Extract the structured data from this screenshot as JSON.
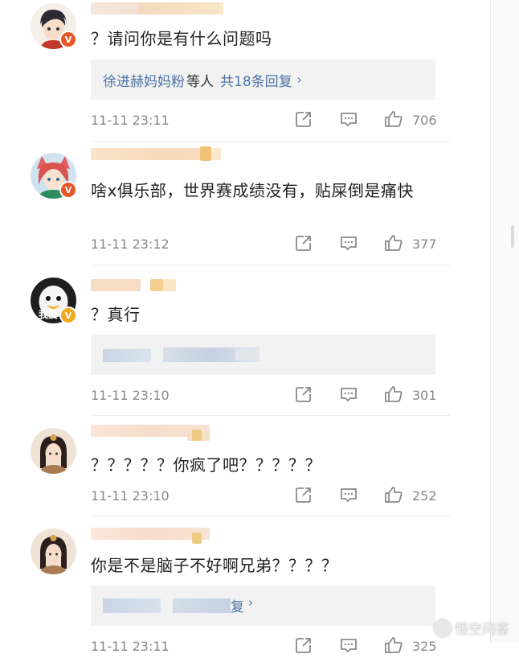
{
  "comments": [
    {
      "text": "？请问你是有什么问题吗",
      "reply": {
        "names": "徐进赫妈妈粉",
        "mid": "等人",
        "total": "共18条回复",
        "chevron": "›"
      },
      "time": "11-11 23:11",
      "likes": "706",
      "badge": "V",
      "badge_color": "#e8572a"
    },
    {
      "text": "啥x俱乐部，世界赛成绩没有，贴屎倒是痛快",
      "time": "11-11 23:12",
      "likes": "377",
      "badge": "V",
      "badge_color": "#e8572a"
    },
    {
      "text": "？真行",
      "time": "11-11 23:10",
      "likes": "301",
      "avatar_label": "我爱",
      "badge": "V",
      "badge_color": "#f2a81f"
    },
    {
      "text": "？？？？？你疯了吧？？？？？",
      "time": "11-11 23:10",
      "likes": "252"
    },
    {
      "text": "你是不是脑子不好啊兄弟？？？？",
      "reply": {
        "tail": "复",
        "chevron": "›"
      },
      "time": "11-11 23:11",
      "likes": "325"
    }
  ],
  "watermark": "悟空问答",
  "icons": {
    "share": "share-icon",
    "comment": "comment-icon",
    "like": "thumbs-up-icon"
  }
}
